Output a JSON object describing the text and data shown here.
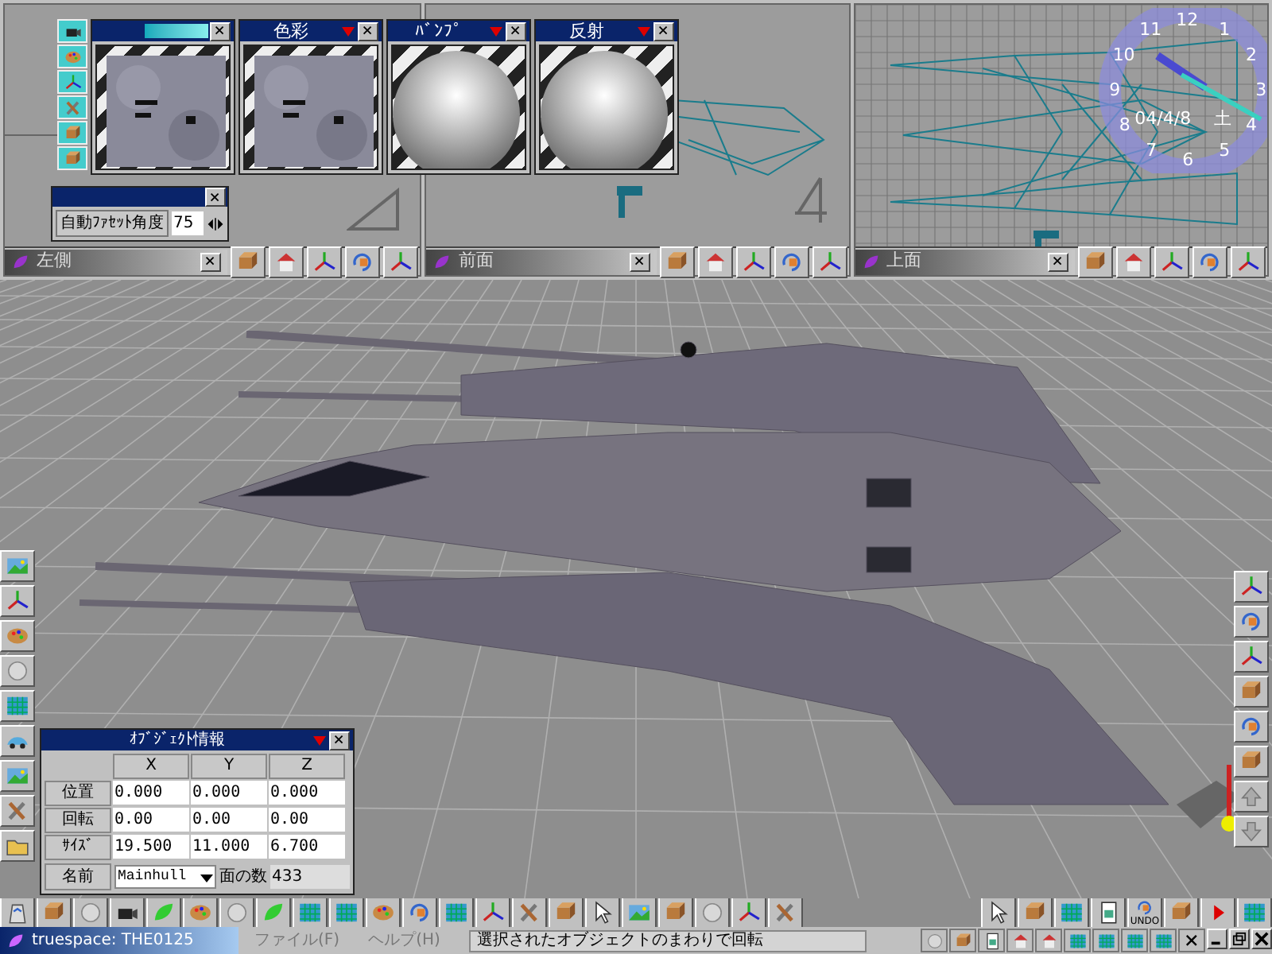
{
  "viewports": [
    {
      "title": "左側"
    },
    {
      "title": "前面"
    },
    {
      "title": "上面"
    }
  ],
  "material_editors": [
    {
      "kind": "texture"
    },
    {
      "kind": "texture",
      "title": "色彩"
    },
    {
      "kind": "sphere",
      "title": "ﾊﾞﾝﾌﾟ"
    },
    {
      "kind": "sphere",
      "title": "反射"
    }
  ],
  "facet_panel": {
    "label": "自動ﾌｧｾｯﾄ角度",
    "value": "75"
  },
  "clock": {
    "hours": [
      "12",
      "1",
      "2",
      "3",
      "4",
      "5",
      "6",
      "7",
      "8",
      "9",
      "10",
      "11"
    ],
    "date": "04/4/8",
    "weekday": "土"
  },
  "object_info": {
    "title": "ｵﾌﾞｼﾞｪｸﾄ情報",
    "columns": [
      "X",
      "Y",
      "Z"
    ],
    "rows": [
      {
        "label": "位置",
        "values": [
          "0.000",
          "0.000",
          "0.000"
        ]
      },
      {
        "label": "回転",
        "values": [
          "0.00",
          "0.00",
          "0.00"
        ]
      },
      {
        "label": "ｻｲｽﾞ",
        "values": [
          "19.500",
          "11.000",
          "6.700"
        ]
      }
    ],
    "name_label": "名前",
    "name_value": "Mainhull",
    "faces_label": "面の数",
    "faces_value": "433"
  },
  "undo_label": "UNDO",
  "taskbar": {
    "app": "truespace: THE0125",
    "menus": [
      "ファイル(F)",
      "ヘルプ(H)"
    ],
    "status": "選択されたオブジェクトのまわりで回転"
  }
}
